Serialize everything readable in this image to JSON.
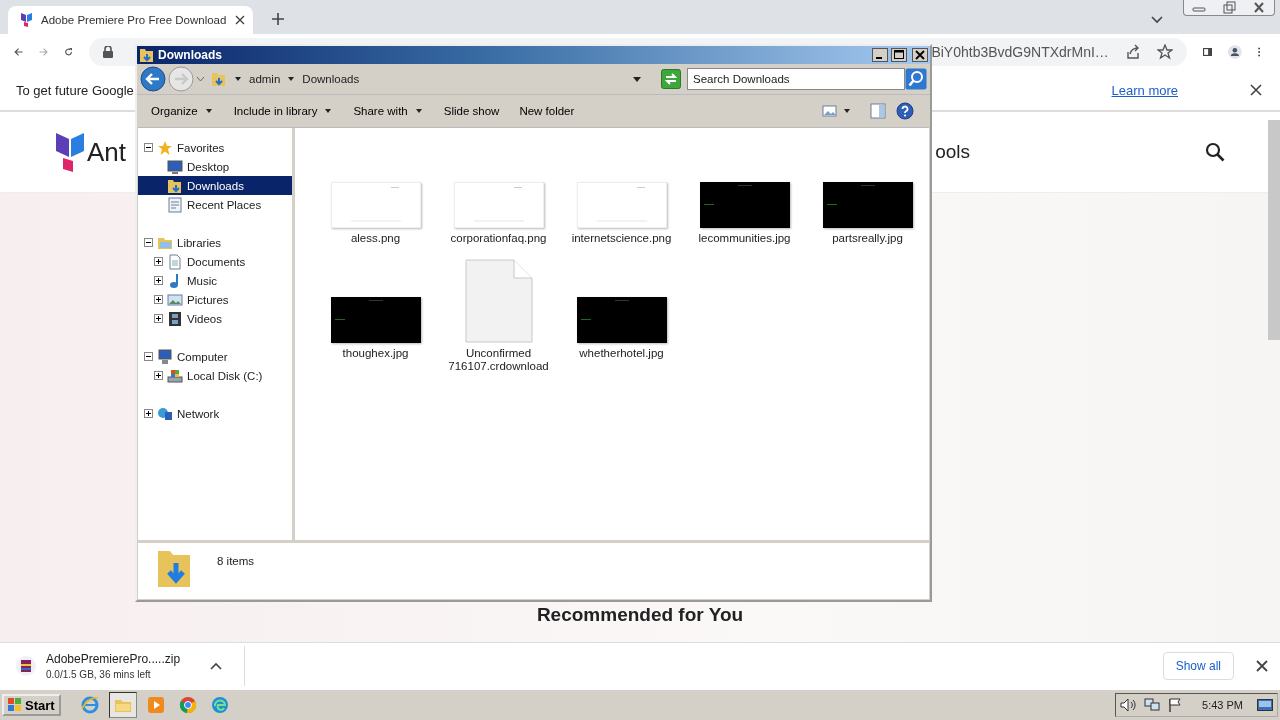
{
  "browser": {
    "tabs": [
      {
        "title": "Adobe Premiere Pro Free Download",
        "selected": true
      }
    ],
    "address": "BiY0htb3BvdG9NTXdrMnI…",
    "infobar": {
      "text": "To get future Google",
      "link": "Learn more"
    }
  },
  "site": {
    "logo_text": "Ant",
    "nav_item": "ools",
    "heading": "Recommended for You"
  },
  "download": {
    "file": "AdobePremierePro.....zip",
    "status": "0.0/1.5 GB, 36 mins left",
    "show_all": "Show all"
  },
  "explorer": {
    "title": "Downloads",
    "breadcrumb": [
      "admin",
      "Downloads"
    ],
    "search": {
      "placeholder": "Search Downloads"
    },
    "toolbar": [
      {
        "label": "Organize",
        "dropdown": true
      },
      {
        "label": "Include in library",
        "dropdown": true
      },
      {
        "label": "Share with",
        "dropdown": true
      },
      {
        "label": "Slide show",
        "dropdown": false
      },
      {
        "label": "New folder",
        "dropdown": false
      }
    ],
    "sidebar": [
      {
        "label": "Favorites",
        "kind": "star",
        "expanded": true,
        "selected": false,
        "children": [
          {
            "label": "Desktop",
            "kind": "desktop",
            "selected": false
          },
          {
            "label": "Downloads",
            "kind": "folder",
            "selected": true
          },
          {
            "label": "Recent Places",
            "kind": "recent",
            "selected": false
          }
        ]
      },
      {
        "label": "Libraries",
        "kind": "library",
        "expanded": true,
        "selected": false,
        "children": [
          {
            "label": "Documents",
            "kind": "document",
            "expanded": false,
            "selected": false
          },
          {
            "label": "Music",
            "kind": "music",
            "expanded": false,
            "selected": false
          },
          {
            "label": "Pictures",
            "kind": "pictures",
            "expanded": false,
            "selected": false
          },
          {
            "label": "Videos",
            "kind": "video",
            "expanded": false,
            "selected": false
          }
        ]
      },
      {
        "label": "Computer",
        "kind": "computer",
        "expanded": true,
        "selected": false,
        "children": [
          {
            "label": "Local Disk (C:)",
            "kind": "disk",
            "expanded": false,
            "selected": false
          }
        ]
      },
      {
        "label": "Network",
        "kind": "network",
        "expanded": false,
        "selected": false
      }
    ],
    "files": [
      {
        "name": "aless.png",
        "kind": "light"
      },
      {
        "name": "corporationfaq.png",
        "kind": "light"
      },
      {
        "name": "internetscience.png",
        "kind": "light"
      },
      {
        "name": "lecommunities.jpg",
        "kind": "dark"
      },
      {
        "name": "partsreally.jpg",
        "kind": "dark"
      },
      {
        "name": "thoughex.jpg",
        "kind": "dark"
      },
      {
        "name": "Unconfirmed 716107.crdownload",
        "kind": "document"
      },
      {
        "name": "whetherhotel.jpg",
        "kind": "dark"
      }
    ],
    "status": "8 items"
  },
  "taskbar": {
    "start": "Start",
    "clock": "5:43 PM",
    "apps": [
      {
        "kind": "ie",
        "selected": false
      },
      {
        "kind": "explorer",
        "selected": true
      },
      {
        "kind": "media",
        "selected": false
      },
      {
        "kind": "chrome",
        "selected": false
      },
      {
        "kind": "edge",
        "selected": false
      }
    ]
  }
}
